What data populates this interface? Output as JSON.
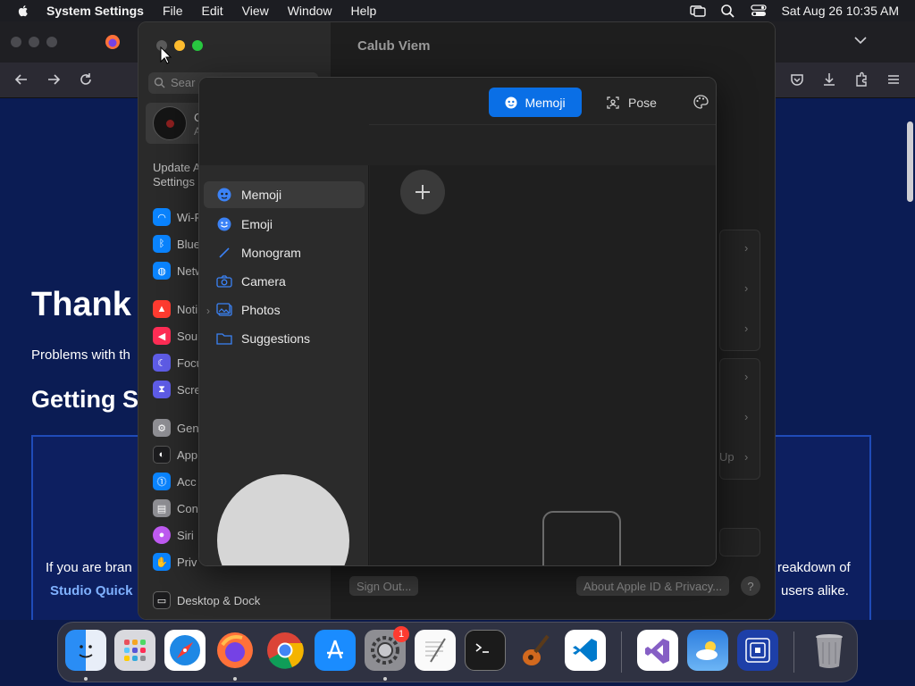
{
  "menubar": {
    "app_name": "System Settings",
    "items": [
      "File",
      "Edit",
      "View",
      "Window",
      "Help"
    ],
    "clock": "Sat Aug 26  10:35 AM"
  },
  "browser": {
    "heading": "Thank",
    "paragraph": "Problems with th",
    "subheading": "Getting S",
    "card_left_line1": "If you are bran",
    "card_left_link": "Studio Quick",
    "card_right_line1": "reakdown of",
    "card_right_line2": "users alike."
  },
  "settings": {
    "search_placeholder": "Sear",
    "account_name": "C",
    "account_sub": "A",
    "update_text": "Update A Settings",
    "sidebar_items": [
      {
        "label": "Wi-F",
        "icon": "wifi-icon",
        "color": "#0a84ff"
      },
      {
        "label": "Blue",
        "icon": "bluetooth-icon",
        "color": "#0a84ff"
      },
      {
        "label": "Netw",
        "icon": "network-icon",
        "color": "#0a84ff"
      },
      {
        "label": "Noti",
        "icon": "notifications-icon",
        "color": "#ff3b30"
      },
      {
        "label": "Sou",
        "icon": "sound-icon",
        "color": "#ff2d55"
      },
      {
        "label": "Focu",
        "icon": "focus-icon",
        "color": "#5e5ce6"
      },
      {
        "label": "Scre",
        "icon": "screen-time-icon",
        "color": "#5e5ce6"
      },
      {
        "label": "Gen",
        "icon": "general-icon",
        "color": "#8e8e93"
      },
      {
        "label": "App",
        "icon": "appearance-icon",
        "color": "#1c1c1e"
      },
      {
        "label": "Acc",
        "icon": "accessibility-icon",
        "color": "#0a84ff"
      },
      {
        "label": "Con",
        "icon": "control-center-icon",
        "color": "#8e8e93"
      },
      {
        "label": "Siri",
        "icon": "siri-icon",
        "color": "#bf5af2"
      },
      {
        "label": "Priv",
        "icon": "privacy-icon",
        "color": "#0a84ff"
      },
      {
        "label": "Desktop & Dock",
        "icon": "desktop-dock-icon",
        "color": "#1c1c1e"
      }
    ],
    "title": "Calub Viem",
    "up_label": "Up",
    "sign_out": "Sign Out...",
    "about": "About Apple ID & Privacy...",
    "help": "?"
  },
  "sheet": {
    "tab_memoji": "Memoji",
    "tab_pose": "Pose",
    "sources": [
      {
        "label": "Memoji",
        "icon": "memoji-icon"
      },
      {
        "label": "Emoji",
        "icon": "emoji-icon"
      },
      {
        "label": "Monogram",
        "icon": "monogram-icon"
      },
      {
        "label": "Camera",
        "icon": "camera-icon"
      },
      {
        "label": "Photos",
        "icon": "photos-icon"
      },
      {
        "label": "Suggestions",
        "icon": "folder-icon"
      }
    ]
  },
  "dock": {
    "apps": [
      "Finder",
      "Launchpad",
      "Safari",
      "Firefox",
      "Chrome",
      "App Store",
      "System Settings",
      "TextEdit",
      "Terminal",
      "GarageBand",
      "Visual Studio Code",
      "Visual Studio",
      "Weather",
      "Screen Sharing",
      "Trash"
    ],
    "settings_badge": "1"
  },
  "colors": {
    "accent": "#0a6fe6",
    "red": "#ff5f57",
    "yellow": "#febc2e",
    "green": "#28c840"
  }
}
